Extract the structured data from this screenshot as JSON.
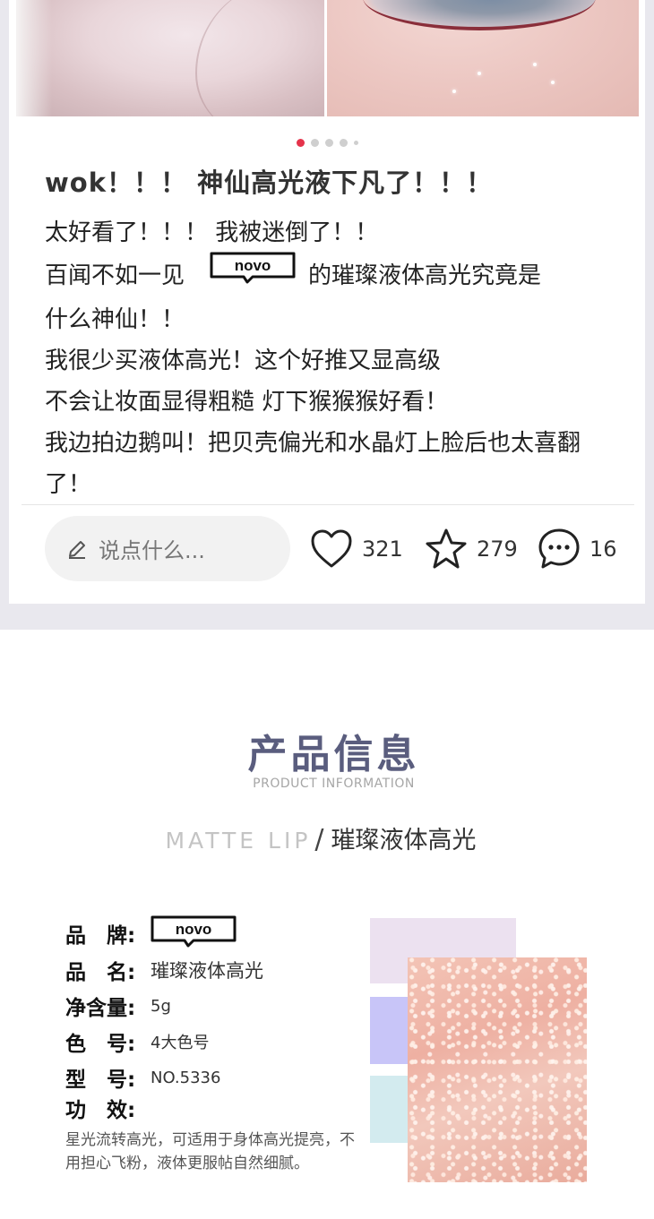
{
  "post": {
    "title": "wok！！！ 神仙高光液下凡了！！！",
    "lines": [
      "太好看了！！！ 我被迷倒了！！",
      "百闻不如一见",
      "的璀璨液体高光究竟是",
      "什么神仙！！",
      "我很少买液体高光！这个好推又显高级",
      "不会让妆面显得粗糙 灯下猴猴猴好看！",
      "我边拍边鹅叫！把贝壳偏光和水晶灯上脸后也太喜翻",
      "了！"
    ],
    "brand_logo_text": "novo",
    "carousel": {
      "count": 5,
      "active_index": 0
    },
    "comment_placeholder": "说点什么...",
    "likes": "321",
    "favorites": "279",
    "comments": "16"
  },
  "product_info": {
    "title": "产品信息",
    "subtitle": "PRODUCT INFORMATION",
    "line_en": "MATTE LIP",
    "line_slash": "/",
    "line_cn": "璀璨液体高光",
    "specs": {
      "brand_label": "品　牌:",
      "brand_logo_text": "novo",
      "name_label": "品　名:",
      "name_value": "璀璨液体高光",
      "weight_label": "净含量:",
      "weight_value": "5g",
      "color_label": "色　号:",
      "color_value": "4大色号",
      "model_label": "型　号:",
      "model_value": "NO.5336",
      "effect_label": "功　效:",
      "effect_text": "星光流转高光，可适用于身体高光提亮，不用担心飞粉，液体更服帖自然细腻。"
    }
  },
  "colors": {
    "accent_red": "#e5334b",
    "title_purple": "#5a5d7e",
    "swatch_pink": "#ece1f0",
    "swatch_lavender": "#c8c5f8",
    "swatch_blue": "#d3ebef",
    "glitter_peach": "#eeb0a2"
  },
  "icons": [
    "pencil-icon",
    "heart-icon",
    "star-icon",
    "comment-bubble-icon",
    "novo-logo"
  ]
}
